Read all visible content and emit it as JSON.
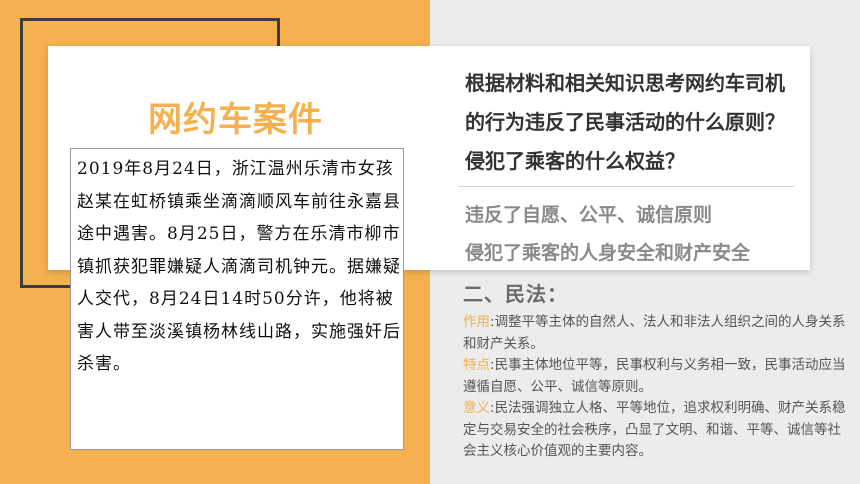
{
  "title": "网约车案件",
  "question": "根据材料和相关知识思考网约车司机的行为违反了民事活动的什么原则？侵犯了乘客的什么权益？",
  "answers": [
    "违反了自愿、公平、诚信原则",
    "侵犯了乘客的人身安全和财产安全"
  ],
  "case_text": "2019年8月24日，浙江温州乐清市女孩赵某在虹桥镇乘坐滴滴顺风车前往永嘉县途中遇害。8月25日，警方在乐清市柳市镇抓获犯罪嫌疑人滴滴司机钟元。据嫌疑人交代，8月24日14时50分许，他将被害人带至淡溪镇杨林线山路，实施强奸后杀害。",
  "law": {
    "heading": "二、民法：",
    "items": [
      {
        "label": "作用",
        "sep": ":",
        "text": "调整平等主体的自然人、法人和非法人组织之间的人身关系和财产关系。"
      },
      {
        "label": "特点",
        "sep": ":",
        "text": "民事主体地位平等，民事权利与义务相一致，民事活动应当遵循自愿、公平、诚信等原则。"
      },
      {
        "label": "意义",
        "sep": ":",
        "text": "民法强调独立人格、平等地位，追求权利明确、财产关系稳定与交易安全的社会秩序，凸显了文明、和谐、平等、诚信等社会主义核心价值观的主要内容。"
      }
    ]
  },
  "colors": {
    "accent": "#f5b04f",
    "dark": "#3d3d3d"
  }
}
